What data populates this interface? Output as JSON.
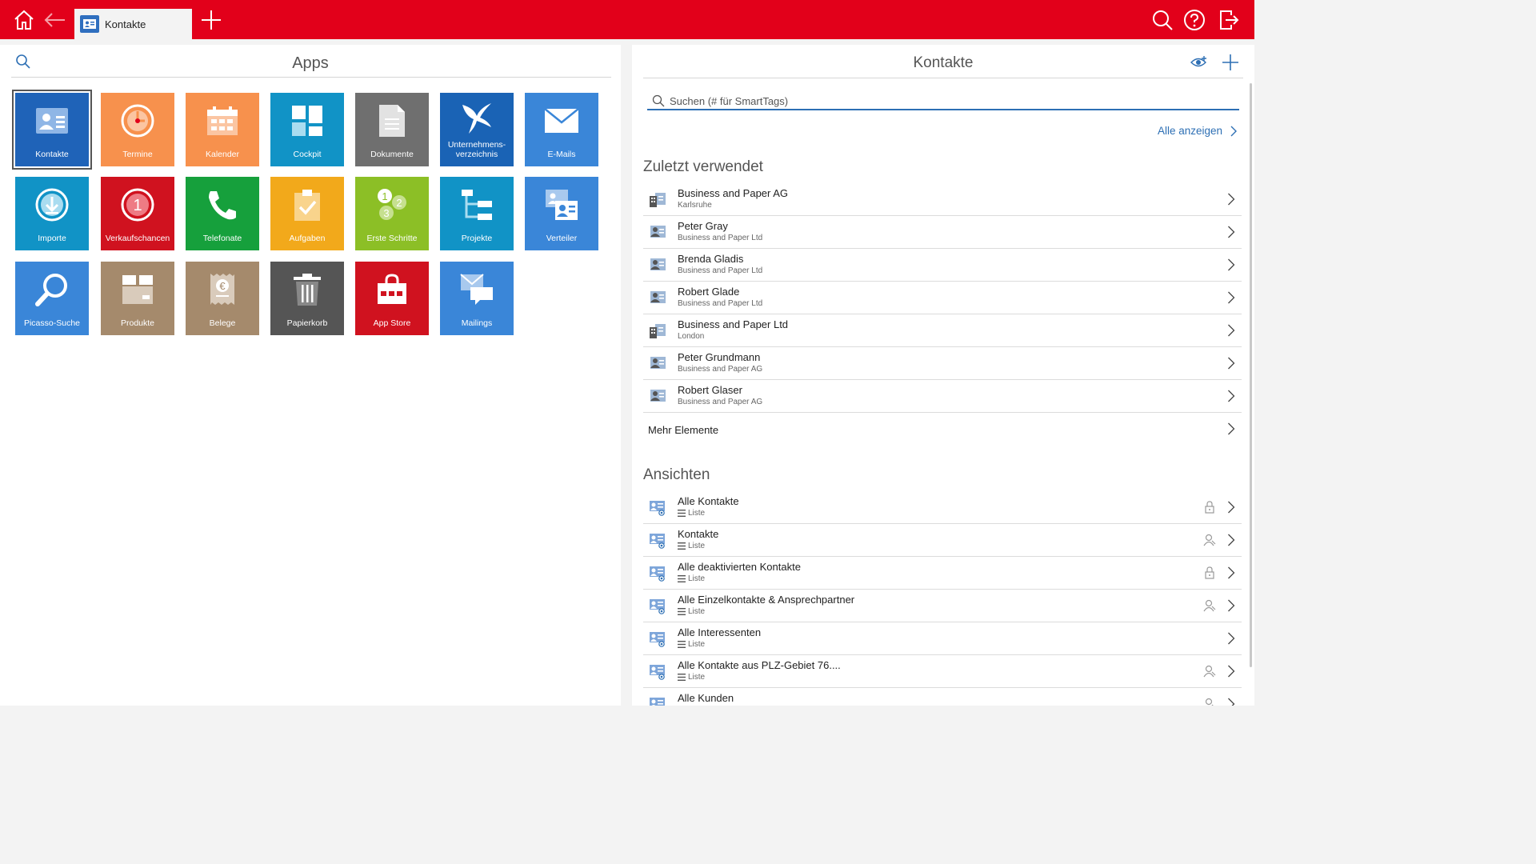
{
  "topbar": {
    "tab_label": "Kontakte"
  },
  "apps_panel": {
    "title": "Apps",
    "tiles": [
      {
        "label": "Kontakte",
        "color": "#1f63b8",
        "icon": "contact-card-icon"
      },
      {
        "label": "Termine",
        "color": "#f7914d",
        "icon": "clock-icon"
      },
      {
        "label": "Kalender",
        "color": "#f7914d",
        "icon": "calendar-icon"
      },
      {
        "label": "Cockpit",
        "color": "#1193c6",
        "icon": "dashboard-icon"
      },
      {
        "label": "Dokumente",
        "color": "#6f6f6f",
        "icon": "document-icon"
      },
      {
        "label": "Unternehmens-verzeichnis",
        "label_line1": "Unternehmens-",
        "label_line2": "verzeichnis",
        "color": "#1a63b5",
        "icon": "company-directory-icon"
      },
      {
        "label": "E-Mails",
        "color": "#3a86d8",
        "icon": "envelope-icon"
      },
      {
        "label": "Importe",
        "color": "#1193c6",
        "icon": "download-icon"
      },
      {
        "label": "Verkaufschancen",
        "color": "#d0121f",
        "icon": "opportunity-icon"
      },
      {
        "label": "Telefonate",
        "color": "#16a03c",
        "icon": "phone-icon"
      },
      {
        "label": "Aufgaben",
        "color": "#f2a91b",
        "icon": "task-clipboard-icon"
      },
      {
        "label": "Erste Schritte",
        "color": "#8cbf26",
        "icon": "first-steps-icon"
      },
      {
        "label": "Projekte",
        "color": "#1193c6",
        "icon": "project-tree-icon"
      },
      {
        "label": "Verteiler",
        "color": "#3a86d8",
        "icon": "distribution-list-icon"
      },
      {
        "label": "Picasso-Suche",
        "color": "#3a86d8",
        "icon": "magnifier-icon"
      },
      {
        "label": "Produkte",
        "color": "#a58a6c",
        "icon": "box-icon"
      },
      {
        "label": "Belege",
        "color": "#a58a6c",
        "icon": "receipt-euro-icon"
      },
      {
        "label": "Papierkorb",
        "color": "#555555",
        "icon": "trash-icon"
      },
      {
        "label": "App Store",
        "color": "#d0121f",
        "icon": "shopping-bag-icon"
      },
      {
        "label": "Mailings",
        "color": "#3a86d8",
        "icon": "mailing-icon"
      }
    ]
  },
  "contacts_panel": {
    "title": "Kontakte",
    "search_placeholder": "Suchen (# für SmartTags)",
    "show_all_label": "Alle anzeigen",
    "recent_heading": "Zuletzt verwendet",
    "recent": [
      {
        "name": "Business and Paper AG",
        "sub": "Karlsruhe",
        "type": "company"
      },
      {
        "name": "Peter Gray",
        "sub": "Business and Paper Ltd",
        "type": "person"
      },
      {
        "name": "Brenda Gladis",
        "sub": "Business and Paper Ltd",
        "type": "person"
      },
      {
        "name": "Robert Glade",
        "sub": "Business and Paper Ltd",
        "type": "person"
      },
      {
        "name": "Business and Paper Ltd",
        "sub": "London",
        "type": "company"
      },
      {
        "name": "Peter Grundmann",
        "sub": "Business and Paper AG",
        "type": "person"
      },
      {
        "name": "Robert Glaser",
        "sub": "Business and Paper AG",
        "type": "person"
      }
    ],
    "more_label": "Mehr Elemente",
    "views_heading": "Ansichten",
    "views": [
      {
        "name": "Alle Kontakte",
        "sub": "Liste",
        "extra": "lock"
      },
      {
        "name": "Kontakte",
        "sub": "Liste",
        "extra": "user"
      },
      {
        "name": "Alle deaktivierten Kontakte",
        "sub": "Liste",
        "extra": "lock"
      },
      {
        "name": "Alle Einzelkontakte & Ansprechpartner",
        "sub": "Liste",
        "extra": "user"
      },
      {
        "name": "Alle Interessenten",
        "sub": "Liste",
        "extra": ""
      },
      {
        "name": "Alle Kontakte aus PLZ-Gebiet 76....",
        "sub": "Liste",
        "extra": "user"
      },
      {
        "name": "Alle Kunden",
        "sub": "",
        "extra": "user"
      }
    ]
  }
}
